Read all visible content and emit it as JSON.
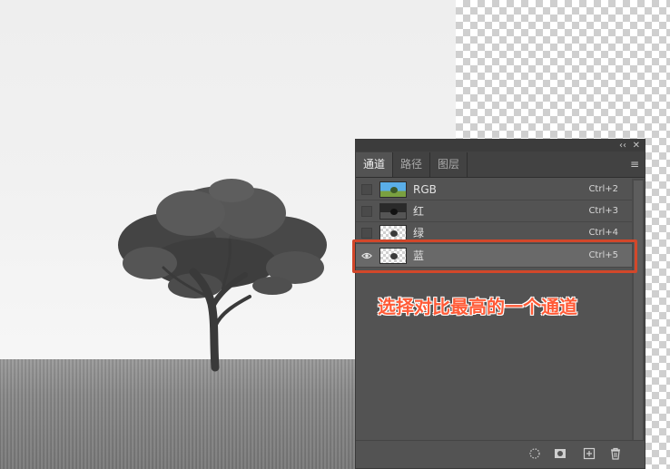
{
  "panel": {
    "tabs": [
      {
        "label": "通道",
        "active": true
      },
      {
        "label": "路径",
        "active": false
      },
      {
        "label": "图层",
        "active": false
      }
    ],
    "channels": [
      {
        "label": "RGB",
        "shortcut": "Ctrl+2",
        "visible": false,
        "thumb": "rgb"
      },
      {
        "label": "红",
        "shortcut": "Ctrl+3",
        "visible": false,
        "thumb": "dark"
      },
      {
        "label": "绿",
        "shortcut": "Ctrl+4",
        "visible": false,
        "thumb": "light"
      },
      {
        "label": "蓝",
        "shortcut": "Ctrl+5",
        "visible": true,
        "selected": true,
        "thumb": "light"
      }
    ],
    "icons": {
      "collapse": "double-chevron-left-icon",
      "close": "close-icon",
      "menu": "hamburger-menu-icon",
      "bottom": [
        "load-selection-icon",
        "save-selection-icon",
        "new-channel-icon",
        "trash-icon"
      ]
    }
  },
  "annotation": {
    "text": "选择对比最高的一个通道",
    "color": "#ff5a36"
  },
  "colors": {
    "highlight": "#d2472a",
    "panel_bg": "#535353"
  }
}
